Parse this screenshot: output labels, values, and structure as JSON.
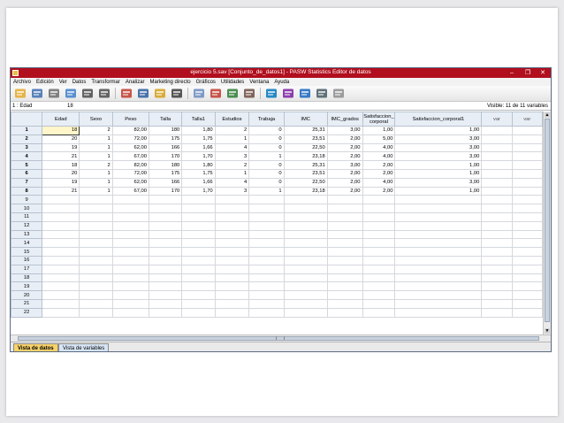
{
  "window": {
    "title": "ejercicio 5.sav [Conjunto_de_datos1] - PASW Statistics Editor de datos",
    "min_glyph": "–",
    "max_glyph": "❐",
    "close_glyph": "✕"
  },
  "menu": [
    "Archivo",
    "Edición",
    "Ver",
    "Datos",
    "Transformar",
    "Analizar",
    "Marketing directo",
    "Gráficos",
    "Utilidades",
    "Ventana",
    "Ayuda"
  ],
  "toolbar_icons": [
    "open-folder-icon",
    "save-icon",
    "print-icon",
    "dialog-recall-icon",
    "undo-icon",
    "redo-icon",
    "goto-case-icon",
    "goto-variable-icon",
    "variables-icon",
    "find-icon",
    "insert-cases-icon",
    "insert-variable-icon",
    "split-file-icon",
    "weight-cases-icon",
    "select-cases-icon",
    "value-labels-icon",
    "use-sets-icon",
    "show-sets-icon",
    "spelling-icon"
  ],
  "cell_editor": {
    "reference": "1 : Edad",
    "value": "18",
    "visible_info": "Visible: 11 de 11 variables"
  },
  "columns": [
    "Edad",
    "Sexo",
    "Peso",
    "Talla",
    "Talla1",
    "Estudios",
    "Trabaja",
    "IMC",
    "IMC_grados",
    "Satisfaccion_ corporal",
    "Satisfaccion_corporal1",
    "var",
    "var"
  ],
  "rows": [
    [
      "18",
      "2",
      "82,00",
      "180",
      "1,80",
      "2",
      "0",
      "25,31",
      "3,00",
      "1,00",
      "1,00"
    ],
    [
      "20",
      "1",
      "72,00",
      "175",
      "1,75",
      "1",
      "0",
      "23,51",
      "2,00",
      "5,00",
      "3,00"
    ],
    [
      "19",
      "1",
      "62,00",
      "166",
      "1,66",
      "4",
      "0",
      "22,50",
      "2,00",
      "4,00",
      "3,00"
    ],
    [
      "21",
      "1",
      "67,00",
      "170",
      "1,70",
      "3",
      "1",
      "23,18",
      "2,00",
      "4,00",
      "3,00"
    ],
    [
      "18",
      "2",
      "82,00",
      "180",
      "1,80",
      "2",
      "0",
      "25,31",
      "3,00",
      "2,00",
      "1,00"
    ],
    [
      "20",
      "1",
      "72,00",
      "175",
      "1,75",
      "1",
      "0",
      "23,51",
      "2,00",
      "2,00",
      "1,00"
    ],
    [
      "19",
      "1",
      "62,00",
      "166",
      "1,66",
      "4",
      "0",
      "22,50",
      "2,00",
      "4,00",
      "3,00"
    ],
    [
      "21",
      "1",
      "67,00",
      "170",
      "1,70",
      "3",
      "1",
      "23,18",
      "2,00",
      "2,00",
      "1,00"
    ]
  ],
  "row_numbers": [
    "1",
    "2",
    "3",
    "4",
    "5",
    "6",
    "7",
    "8",
    "9",
    "10",
    "11",
    "12",
    "13",
    "14",
    "15",
    "16",
    "17",
    "18",
    "19",
    "20",
    "21",
    "22"
  ],
  "tabs": {
    "data_view": "Vista de datos",
    "variable_view": "Vista de variables"
  },
  "colors": {
    "title_bar": "#b10f1e",
    "header_bg": "#e8eef6",
    "active_tab": "#f8d36a",
    "selected_cell": "#fff6c9"
  }
}
